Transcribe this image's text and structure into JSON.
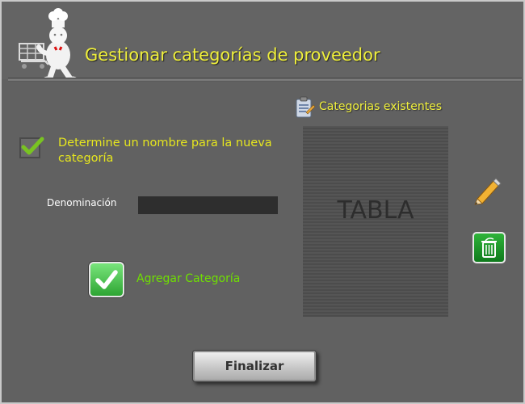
{
  "header": {
    "title": "Gestionar categorías de proveedor",
    "mascot_icon": "chef-with-shopping-cart-icon"
  },
  "existing_categories": {
    "label": "Categorias existentes",
    "icon": "clipboard-list-icon",
    "table_placeholder": "TABLA"
  },
  "form": {
    "instruction": "Determine un nombre para la nueva categoría",
    "name_label": "Denominación",
    "name_value": "",
    "add_label": "Agregar Categoría"
  },
  "actions": {
    "edit_icon": "pencil-icon",
    "delete_icon": "trash-icon",
    "finish_label": "Finalizar"
  },
  "colors": {
    "title": "#f0f03c",
    "instruction": "#e6e61e",
    "add_label": "#6fe000",
    "background": "#616161"
  }
}
